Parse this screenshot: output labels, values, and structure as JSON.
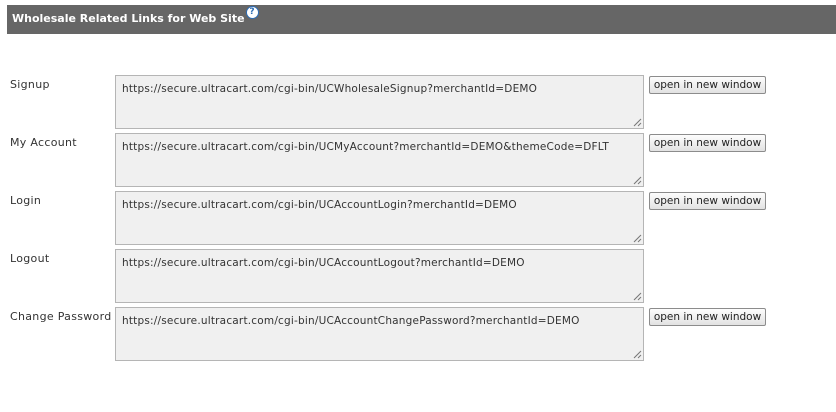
{
  "header": {
    "title": "Wholesale Related Links for Web Site",
    "help_glyph": "?"
  },
  "links": [
    {
      "label": "Signup",
      "url": "https://secure.ultracart.com/cgi-bin/UCWholesaleSignup?merchantId=DEMO",
      "button_label": "open in new window"
    },
    {
      "label": "My Account",
      "url": "https://secure.ultracart.com/cgi-bin/UCMyAccount?merchantId=DEMO&themeCode=DFLT",
      "button_label": "open in new window"
    },
    {
      "label": "Login",
      "url": "https://secure.ultracart.com/cgi-bin/UCAccountLogin?merchantId=DEMO",
      "button_label": "open in new window"
    },
    {
      "label": "Logout",
      "url": "https://secure.ultracart.com/cgi-bin/UCAccountLogout?merchantId=DEMO"
    },
    {
      "label": "Change Password",
      "url": "https://secure.ultracart.com/cgi-bin/UCAccountChangePassword?merchantId=DEMO",
      "button_label": "open in new window"
    }
  ],
  "colors": {
    "header_bg": "#666666",
    "header_text": "#ffffff",
    "help_icon": "#2e6db4",
    "field_bg": "#f0f0f0"
  },
  "icons": {
    "help": "help-icon",
    "resize": "resize-grip-icon"
  }
}
